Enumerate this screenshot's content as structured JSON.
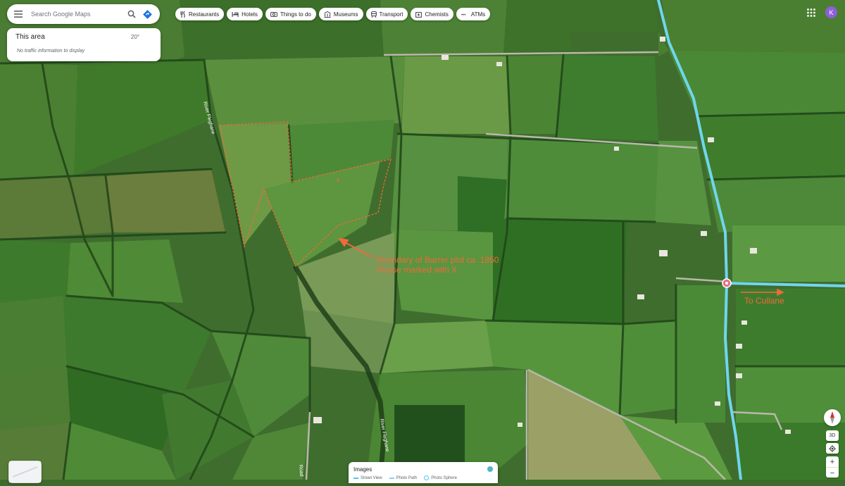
{
  "search": {
    "placeholder": "Search Google Maps"
  },
  "info_card": {
    "title": "This area",
    "temperature": "20°",
    "subtitle": "No traffic information to display"
  },
  "chips": [
    {
      "label": "Restaurants",
      "icon": "fork-knife-icon"
    },
    {
      "label": "Hotels",
      "icon": "bed-icon"
    },
    {
      "label": "Things to do",
      "icon": "camera-icon"
    },
    {
      "label": "Museums",
      "icon": "museum-icon"
    },
    {
      "label": "Transport",
      "icon": "train-icon"
    },
    {
      "label": "Chemists",
      "icon": "pharmacy-icon"
    },
    {
      "label": "ATMs",
      "icon": "atm-icon"
    }
  ],
  "account": {
    "initial": "K"
  },
  "map": {
    "view": "satellite",
    "road_labels": [
      "River Fleghane",
      "River Fleghane",
      "Road"
    ],
    "annotation": {
      "line1": "Boundary of Barrer plot ca. 1850",
      "line2": "House marked with X",
      "direction": "To Cullane"
    },
    "colors": {
      "annotation": "#f06a3b",
      "road": "#6fd6ee",
      "pin": "#e8718a"
    }
  },
  "controls": {
    "three_d": "3D",
    "zoom_in": "+",
    "zoom_out": "−"
  },
  "images_panel": {
    "title": "Images",
    "legend": [
      "Street View",
      "Photo Path",
      "Photo Sphere"
    ]
  }
}
